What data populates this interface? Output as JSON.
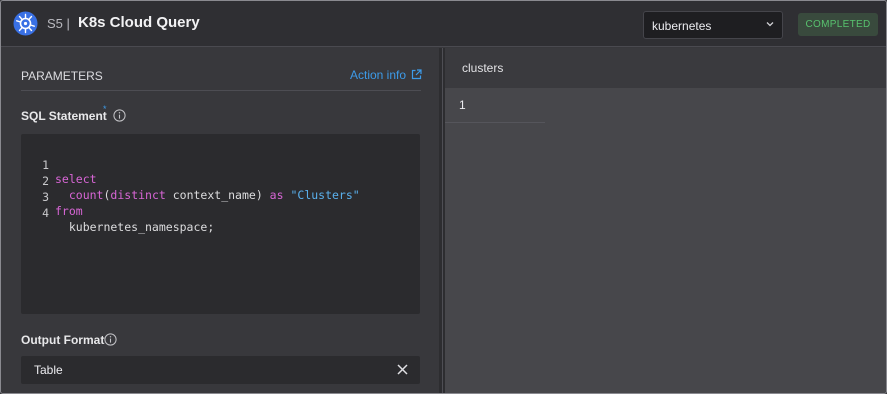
{
  "header": {
    "logo_icon": "kubernetes-helm-icon",
    "step": "S5 |",
    "title": "K8s Cloud Query",
    "connection_select": {
      "value": "kubernetes",
      "icon": "chevron-down-icon"
    },
    "status": "COMPLETED"
  },
  "parameters": {
    "heading": "PARAMETERS",
    "action_info": {
      "label": "Action info",
      "icon": "external-link-icon"
    },
    "sql": {
      "label": "SQL Statement",
      "required_marker": "*",
      "info_icon": "info-icon",
      "lines": [
        {
          "num": "1",
          "parts": [
            {
              "t": "select",
              "c": "kw"
            }
          ]
        },
        {
          "num": "2",
          "parts": [
            {
              "t": "  ",
              "c": "plain"
            },
            {
              "t": "count",
              "c": "fn"
            },
            {
              "t": "(",
              "c": "plain"
            },
            {
              "t": "distinct",
              "c": "fn"
            },
            {
              "t": " context_name) ",
              "c": "plain"
            },
            {
              "t": "as",
              "c": "kw"
            },
            {
              "t": " ",
              "c": "plain"
            },
            {
              "t": "\"Clusters\"",
              "c": "str"
            }
          ]
        },
        {
          "num": "3",
          "parts": [
            {
              "t": "from",
              "c": "kw"
            }
          ]
        },
        {
          "num": "4",
          "parts": [
            {
              "t": "  kubernetes_namespace;",
              "c": "plain"
            }
          ]
        }
      ]
    },
    "output_format": {
      "label": "Output Format",
      "info_icon": "info-icon",
      "value": "Table",
      "clear_icon": "close-icon"
    }
  },
  "results": {
    "columns": [
      "clusters"
    ],
    "rows": [
      [
        "1"
      ]
    ]
  },
  "colors": {
    "accent": "#3d9be9",
    "status_green": "#58c26e",
    "keyword": "#d866d6",
    "string": "#5ab1ee"
  }
}
